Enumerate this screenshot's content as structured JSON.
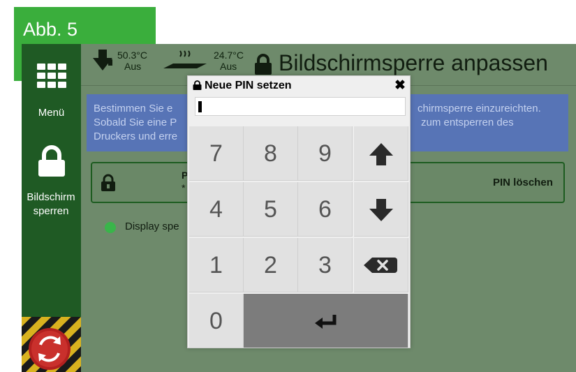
{
  "figure_label": "Abb. 5",
  "sidebar": {
    "menu_label": "Menü",
    "lock_label_line1": "Bildschirm",
    "lock_label_line2": "sperren"
  },
  "header": {
    "temp1_value": "50.3°C",
    "temp1_status": "Aus",
    "temp2_value": "24.7°C",
    "temp2_status": "Aus",
    "title": "Bildschirmsperre anpassen"
  },
  "info": {
    "line1_left": "Bestimmen Sie e",
    "line1_right": "chirmsperre einzureichten.",
    "line2_left": "Sobald Sie eine P",
    "line2_right": "zum entsperren des",
    "line3_left": "Druckers und erre"
  },
  "pin_row": {
    "label": "P",
    "value": "*",
    "delete_label": "PIN löschen"
  },
  "display_toggle": {
    "label": "Display spe"
  },
  "modal": {
    "title": "Neue PIN setzen",
    "close": "✖",
    "input_value": "",
    "keys": [
      "7",
      "8",
      "9",
      "4",
      "5",
      "6",
      "1",
      "2",
      "3",
      "0"
    ]
  },
  "icons": {
    "menu": "grid-icon",
    "lock": "lock-icon",
    "up": "arrow-up-icon",
    "down": "arrow-down-icon",
    "backspace": "backspace-icon",
    "enter": "enter-icon",
    "estop": "emergency-stop-icon"
  },
  "colors": {
    "label_green": "#3aae3c",
    "sidebar": "#1f5a24",
    "background": "#6e8a6b",
    "info": "#5774b6",
    "enter_key": "#7c7c7c"
  }
}
